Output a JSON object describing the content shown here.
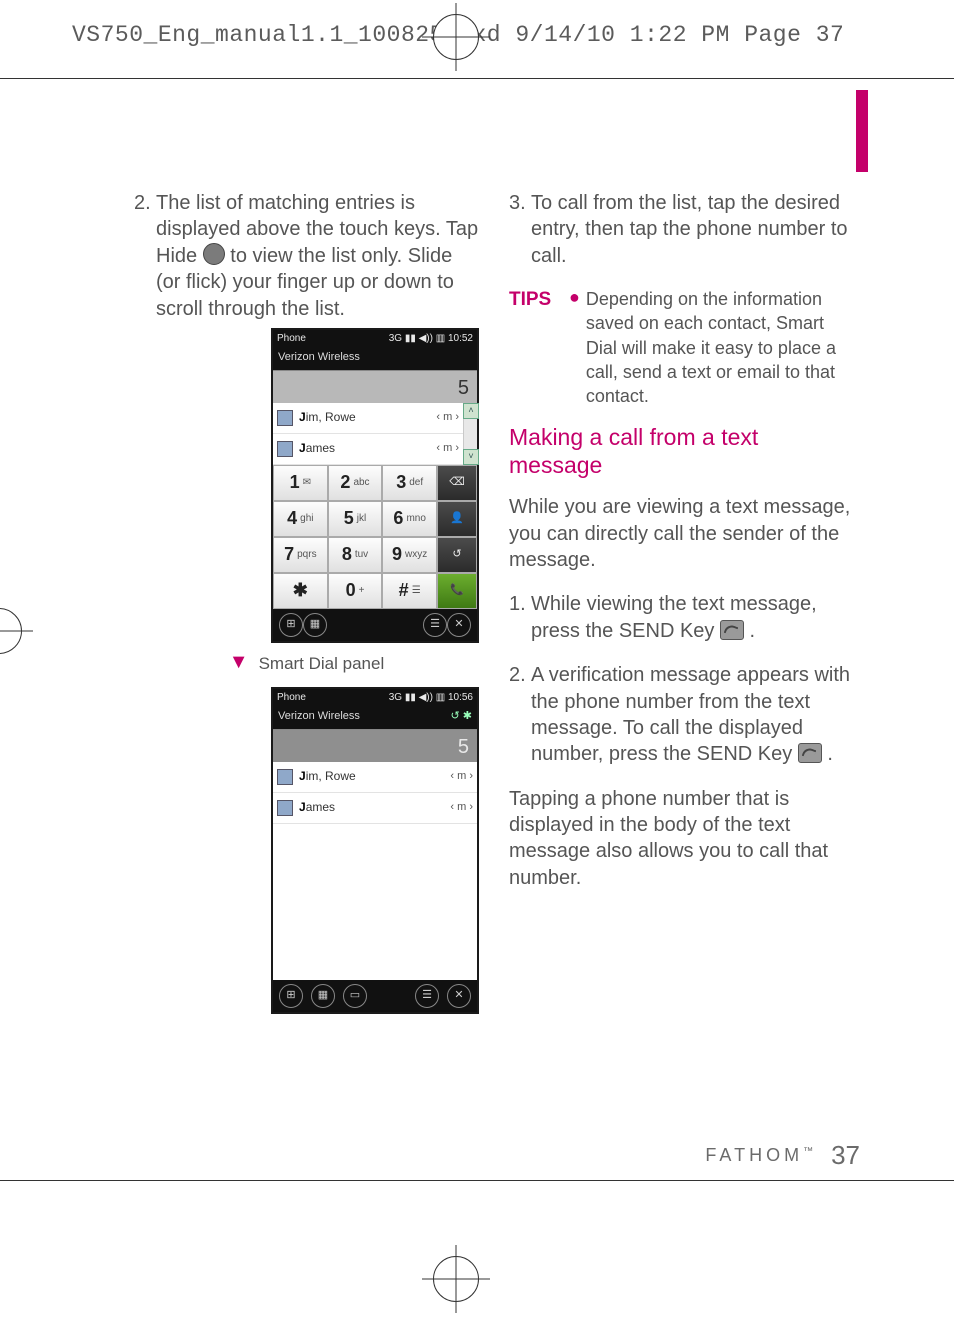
{
  "header": {
    "source_line": "VS750_Eng_manual1.1_100825.qxd  9/14/10  1:22 PM  Page 37"
  },
  "left": {
    "step2_num": "2.",
    "step2_a": "The list of matching entries is displayed above the touch keys. Tap Hide ",
    "step2_b": " to view the list only. Slide (or flick) your finger up or down to scroll through the list.",
    "caption": "Smart Dial panel",
    "phone1": {
      "status_left": "Phone",
      "status_right": "10:52",
      "carrier": "Verizon Wireless",
      "input": "5",
      "row1_name_a": "J",
      "row1_name_b": "im, Rowe",
      "row1_m": "‹ m ›",
      "row2_name_a": "J",
      "row2_name_b": "ames",
      "row2_m": "‹ m ›",
      "k1d": "1",
      "k1l": "",
      "k2d": "2",
      "k2l": "abc",
      "k3d": "3",
      "k3l": "def",
      "k4d": "4",
      "k4l": "ghi",
      "k5d": "5",
      "k5l": "jkl",
      "k6d": "6",
      "k6l": "mno",
      "k7d": "7",
      "k7l": "pqrs",
      "k8d": "8",
      "k8l": "tuv",
      "k9d": "9",
      "k9l": "wxyz",
      "kstar": "✱",
      "k0d": "0",
      "k0l": "+",
      "khash": "#"
    },
    "phone2": {
      "status_left": "Phone",
      "status_right": "10:56",
      "carrier": "Verizon Wireless",
      "input": "5",
      "row1_name_a": "J",
      "row1_name_b": "im, Rowe",
      "row1_m": "‹ m ›",
      "row2_name_a": "J",
      "row2_name_b": "ames",
      "row2_m": "‹ m ›"
    }
  },
  "right": {
    "step3_num": "3.",
    "step3": "To call from the list, tap the desired entry, then tap the phone number to call.",
    "tips_label": "TIPS",
    "tips_body": "Depending on the information saved on each contact, Smart Dial will make it easy to place a call, send a text or email to that contact.",
    "subheading": "Making a call from a text message",
    "intro": "While you are viewing a text message, you can directly call the sender of the message.",
    "r1_num": "1.",
    "r1_a": "While viewing the text message, press the SEND Key ",
    "r1_b": ".",
    "r2_num": "2.",
    "r2_a": "A verification message appears with the phone number from the text message. To call the displayed number, press the SEND Key ",
    "r2_b": ".",
    "closing": "Tapping a phone number that is displayed in the body of the text message also allows you to call that number."
  },
  "footer": {
    "brand": "FATHOM",
    "tm": "™",
    "page": "37"
  }
}
